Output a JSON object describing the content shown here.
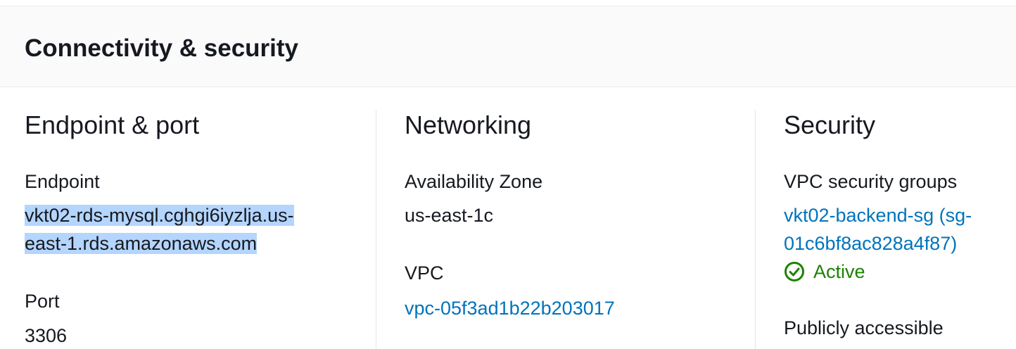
{
  "panel": {
    "title": "Connectivity & security"
  },
  "endpoint_port": {
    "heading": "Endpoint & port",
    "endpoint_label": "Endpoint",
    "endpoint_line1": "vkt02-rds-mysql.cghgi6iyzlja.us-",
    "endpoint_line2": "east-1.rds.amazonaws.com",
    "port_label": "Port",
    "port_value": "3306"
  },
  "networking": {
    "heading": "Networking",
    "az_label": "Availability Zone",
    "az_value": "us-east-1c",
    "vpc_label": "VPC",
    "vpc_value": "vpc-05f3ad1b22b203017"
  },
  "security": {
    "heading": "Security",
    "sg_label": "VPC security groups",
    "sg_line1": "vkt02-backend-sg (sg-",
    "sg_line2": "01c6bf8ac828a4f87)",
    "sg_status": "Active",
    "sg_status_icon": "check-circle-icon",
    "public_label": "Publicly accessible"
  },
  "colors": {
    "link": "#0073bb",
    "success": "#1d8102",
    "selection": "#b4d5fe",
    "header_bg": "#fafafa"
  }
}
